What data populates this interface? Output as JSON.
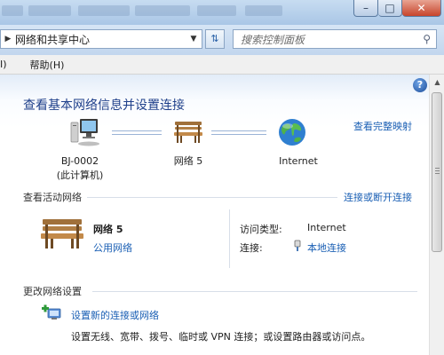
{
  "address_bar": {
    "path": "网络和共享中心",
    "search_placeholder": "搜索控制面板"
  },
  "menu": {
    "items": [
      "I)",
      "帮助(H)"
    ]
  },
  "content": {
    "heading": "查看基本网络信息并设置连接",
    "full_map_link": "查看完整映射",
    "map": {
      "computer_line1": "BJ-0002",
      "computer_line2": "(此计算机)",
      "network_label": "网络  5",
      "internet_label": "Internet"
    },
    "active_networks": {
      "title": "查看活动网络",
      "connect_link": "连接或断开连接",
      "network_name": "网络  5",
      "network_type": "公用网络",
      "access_type_label": "访问类型:",
      "access_type_value": "Internet",
      "connection_label": "连接:",
      "connection_value": "本地连接"
    },
    "change_settings": {
      "title": "更改网络设置",
      "task_title": "设置新的连接或网络",
      "task_desc": "设置无线、宽带、拨号、临时或 VPN 连接；或设置路由器或访问点。"
    }
  },
  "icons": {
    "help": "help-icon",
    "computer": "computer-icon",
    "bench": "public-network-bench-icon",
    "globe": "internet-globe-icon",
    "connection": "lan-connection-icon",
    "new_connection": "new-connection-icon"
  }
}
